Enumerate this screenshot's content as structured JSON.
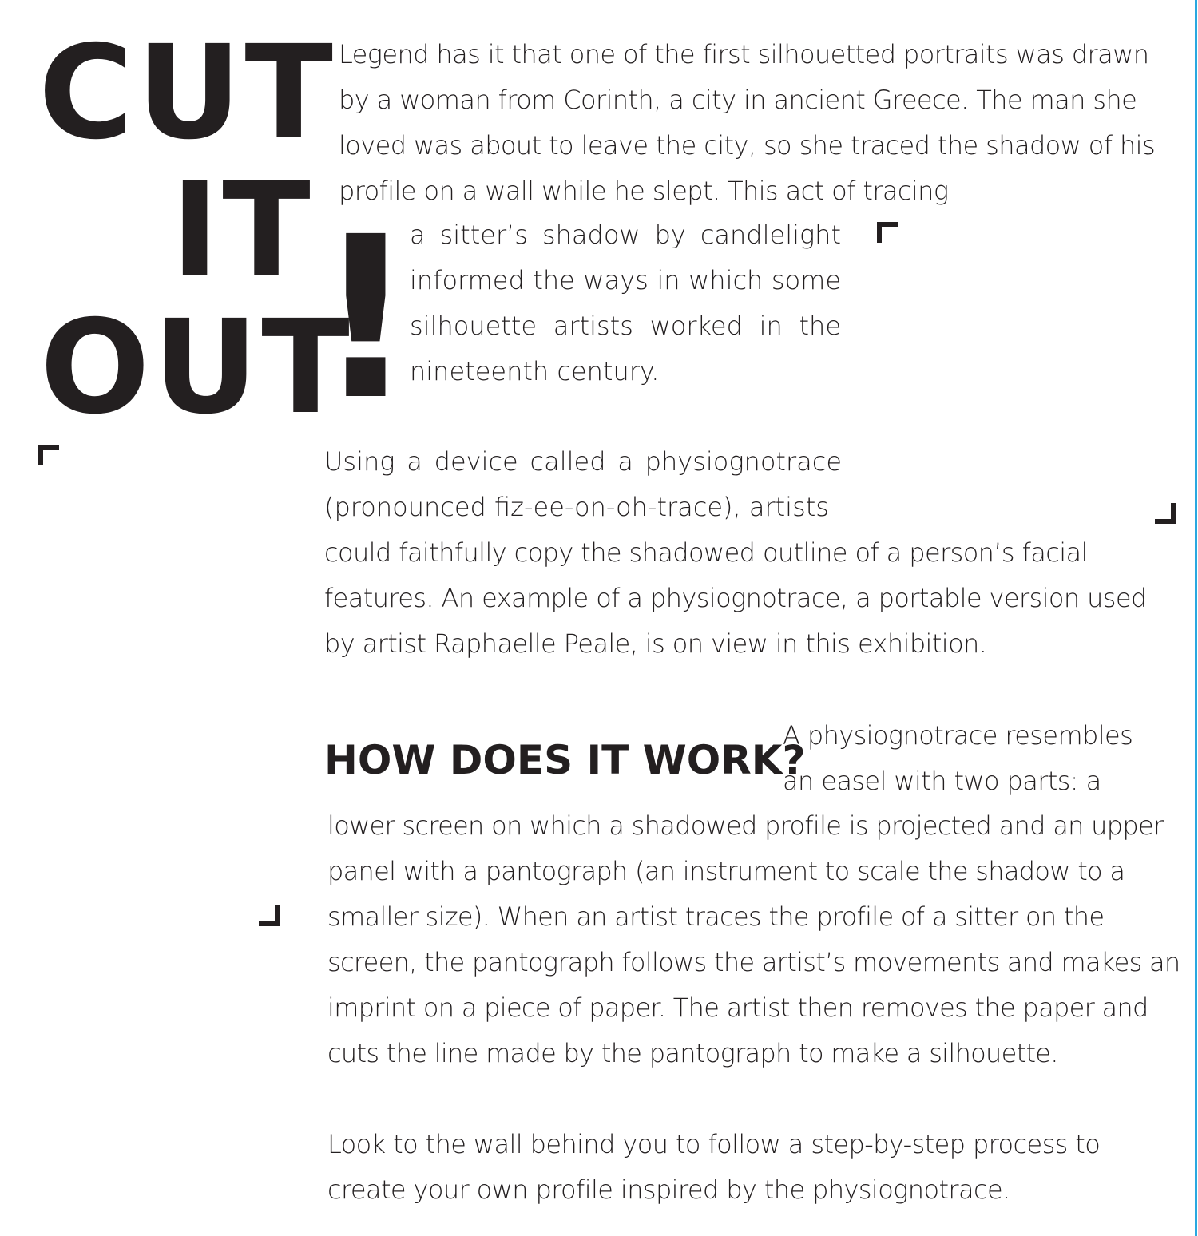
{
  "accent_color": "#29a8e0",
  "text_color": "#231f20",
  "title": {
    "line1": "CUT",
    "line2": "IT",
    "line3": "OUT",
    "exclamation": "!"
  },
  "intro": {
    "part1": "Legend has it that one of the first silhouetted portraits was drawn by a woman from Corinth, a city in ancient Greece. The man she loved was about to leave the city, so she traced the shadow of his profile on a wall while he slept. This act of tracing",
    "part2": "a sitter’s shadow by candlelight informed the ways in which some silhouette artists worked in the nineteenth century."
  },
  "device": {
    "part1": "Using a device called a physiognotrace (pronounced fiz-ee-on-oh-trace), artists",
    "part2": "could faithfully copy the shadowed outline of a person’s facial features. An example of a physiognotrace, a portable version used by artist Raphaelle Peale, is on view in this exhibition."
  },
  "how": {
    "heading": "HOW DOES IT WORK?",
    "part1": "A physiognotrace resembles an easel with two parts: a",
    "part2": "lower screen on which a shadowed profile is projected and an upper panel with a pantograph (an instrument to scale the shadow to a smaller size). When an artist traces the profile of a sitter on the screen, the pantograph follows the artist’s movements and makes an imprint on a piece of paper. The artist then removes the paper and cuts the line made by the pantograph to make a silhouette."
  },
  "closing": "Look to the wall behind you to follow a step-by-step process to create your own profile inspired by the physiognotrace."
}
